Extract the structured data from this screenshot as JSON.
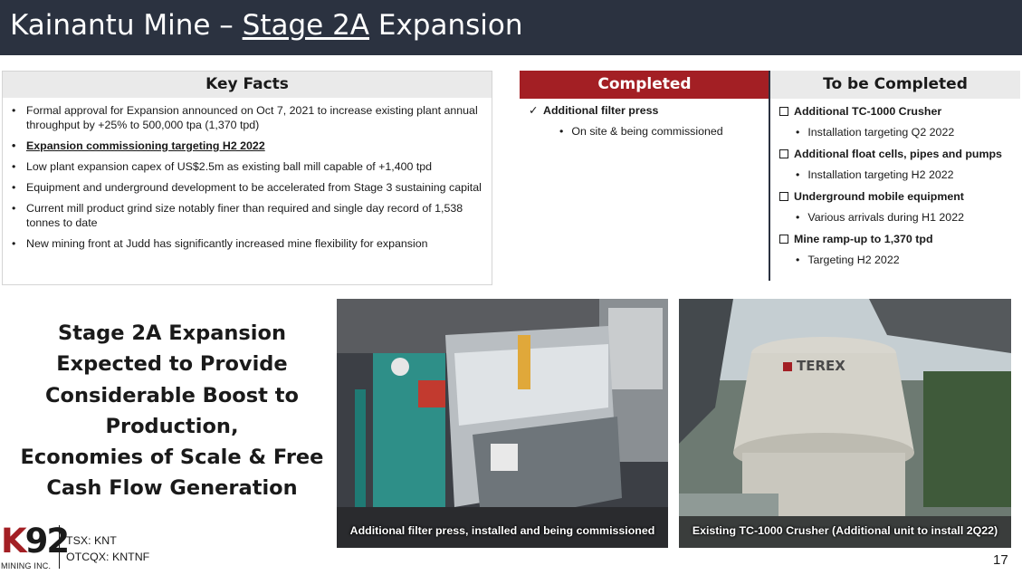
{
  "header": {
    "title_prefix": "Kainantu Mine – ",
    "title_underlined": "Stage 2A",
    "title_suffix": " Expansion"
  },
  "key_facts": {
    "heading": "Key Facts",
    "items": [
      "Formal approval for Expansion announced on Oct 7, 2021 to increase existing plant annual throughput by +25% to 500,000 tpa (1,370 tpd)",
      "Expansion commissioning targeting H2 2022",
      "Low plant expansion capex of US$2.5m as existing ball mill capable of +1,400 tpd",
      "Equipment and underground development to be accelerated from Stage 3 sustaining capital",
      "Current mill product grind size notably finer than required and single day record of 1,538 tonnes to date",
      "New mining front at Judd has significantly increased mine flexibility for expansion"
    ]
  },
  "completed": {
    "heading": "Completed",
    "item": "Additional filter press",
    "sub": "On site & being commissioned"
  },
  "to_be_completed": {
    "heading": "To be Completed",
    "items": [
      {
        "label": "Additional TC-1000 Crusher",
        "sub": "Installation targeting Q2 2022"
      },
      {
        "label": "Additional float cells, pipes and pumps",
        "sub": "Installation targeting H2 2022"
      },
      {
        "label": "Underground mobile equipment",
        "sub": "Various arrivals during H1 2022"
      },
      {
        "label": "Mine ramp-up to 1,370 tpd",
        "sub": "Targeting H2 2022"
      }
    ]
  },
  "statement": {
    "lines": [
      "Stage 2A Expansion",
      "Expected to Provide",
      "Considerable Boost to",
      "Production,",
      "Economies of Scale & Free",
      "Cash Flow Generation"
    ]
  },
  "photos": [
    {
      "caption": "Additional filter press, installed and being commissioned"
    },
    {
      "caption": "Existing TC-1000 Crusher (Additional unit to install 2Q22)",
      "brand_text": "TEREX"
    }
  ],
  "footer": {
    "logo_main": "K92",
    "logo_k": "K",
    "logo_num": "92",
    "logo_sub": "MINING INC.",
    "tsx": "TSX: KNT",
    "otcqx": "OTCQX: KNTNF",
    "page_number": "17"
  },
  "colors": {
    "title_bar": "#2b3240",
    "completed_header": "#a31f24",
    "to_be_completed_header": "#eaeaea",
    "logo_red": "#a31f24"
  }
}
